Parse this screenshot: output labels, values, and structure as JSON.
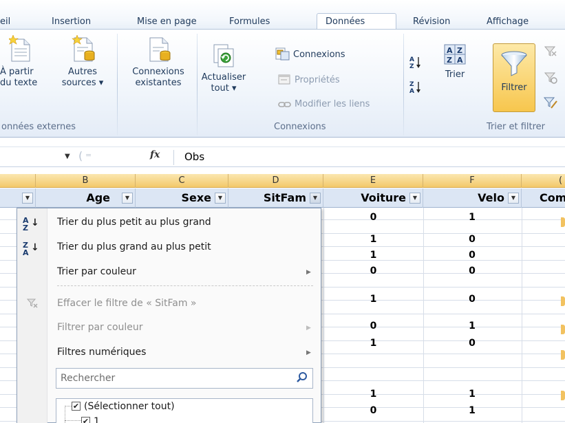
{
  "ribbon_tabs": [
    {
      "label": "eil",
      "active": false
    },
    {
      "label": "Insertion",
      "active": false
    },
    {
      "label": "Mise en page",
      "active": false
    },
    {
      "label": "Formules",
      "active": false
    },
    {
      "label": "Données",
      "active": true
    },
    {
      "label": "Révision",
      "active": false
    },
    {
      "label": "Affichage",
      "active": false
    }
  ],
  "ribbon": {
    "external_data": {
      "from_text_line1": "À partir",
      "from_text_line2": "du texte",
      "other_sources_line1": "Autres",
      "other_sources_line2": "sources ▾",
      "group_label": "onnées externes"
    },
    "existing_connections_line1": "Connexions",
    "existing_connections_line2": "existantes",
    "refresh_all_line1": "Actualiser",
    "refresh_all_line2": "tout ▾",
    "connections": {
      "connections_label": "Connexions",
      "properties_label": "Propriétés",
      "edit_links_label": "Modifier les liens",
      "group_label": "Connexions"
    },
    "sort_filter": {
      "sort_label": "Trier",
      "filter_label": "Filtrer",
      "group_label": "Trier et filtrer"
    }
  },
  "formula_bar": {
    "fx_label": "fx",
    "value": "Obs"
  },
  "columns": [
    "B",
    "C",
    "D",
    "E",
    "F",
    "("
  ],
  "header_row": [
    "Age",
    "Sexe",
    "SitFam",
    "Voiture",
    "Velo",
    "Com"
  ],
  "grid": {
    "voiture": [
      "0",
      "1",
      "1",
      "0",
      "",
      "1",
      "0",
      "1",
      "",
      "1",
      "0"
    ],
    "velo": [
      "1",
      "0",
      "0",
      "0",
      "",
      "0",
      "1",
      "0",
      "",
      "1",
      "1"
    ]
  },
  "filter_menu": {
    "sort_asc": "Trier du plus petit au plus grand",
    "sort_desc": "Trier du plus grand au plus petit",
    "sort_by_color": "Trier par couleur",
    "clear_filter": "Effacer le filtre de « SitFam »",
    "filter_by_color": "Filtrer par couleur",
    "number_filters": "Filtres numériques",
    "search_placeholder": "Rechercher",
    "select_all": "(Sélectionner tout)",
    "first_value": "1"
  },
  "colors": {
    "accent_tab_border": "#b6c6db",
    "filter_active": "#f7c64d",
    "column_header": "#f3c96b"
  }
}
